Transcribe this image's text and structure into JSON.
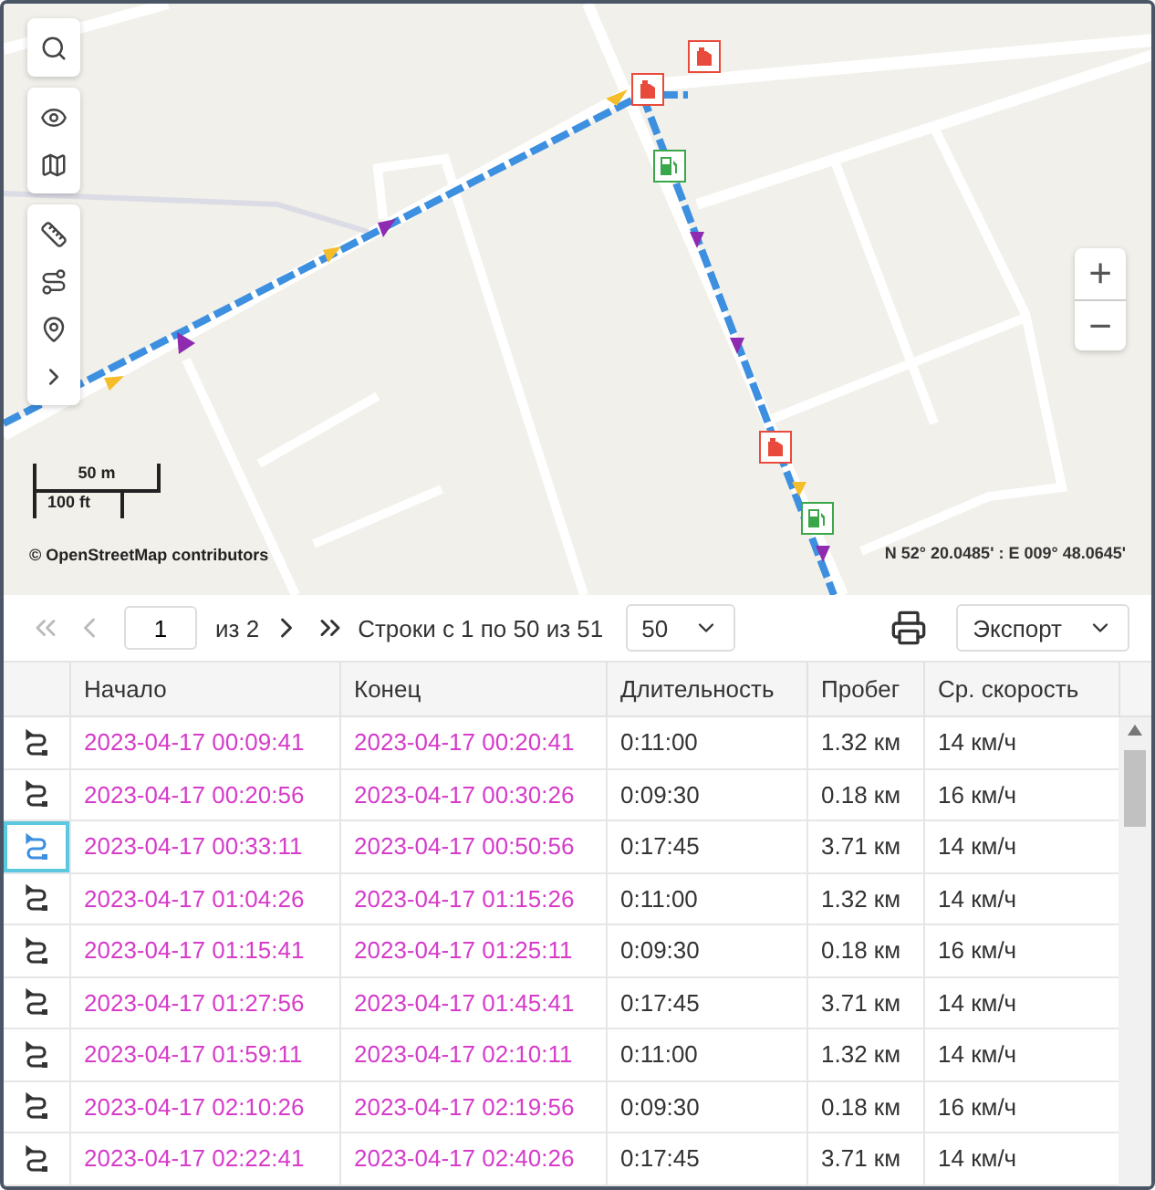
{
  "map": {
    "scale_metric": "50 m",
    "scale_imperial": "100 ft",
    "attribution": "© OpenStreetMap contributors",
    "coordinates": "N 52° 20.0485' : E 009° 48.0645'",
    "zoom_in": "+",
    "zoom_out": "−",
    "markers": [
      {
        "kind": "canister"
      },
      {
        "kind": "canister"
      },
      {
        "kind": "pump"
      },
      {
        "kind": "canister"
      },
      {
        "kind": "pump"
      }
    ]
  },
  "pager": {
    "page": "1",
    "of": "из 2",
    "range": "Строки с 1 по 50 из 51",
    "per_page": "50",
    "export": "Экспорт"
  },
  "table": {
    "columns": [
      "Начало",
      "Конец",
      "Длительность",
      "Пробег",
      "Ср. скорость"
    ],
    "rows": [
      {
        "start": "2023-04-17 00:09:41",
        "end": "2023-04-17 00:20:41",
        "duration": "0:11:00",
        "distance": "1.32 км",
        "speed": "14 км/ч",
        "selected": false
      },
      {
        "start": "2023-04-17 00:20:56",
        "end": "2023-04-17 00:30:26",
        "duration": "0:09:30",
        "distance": "0.18 км",
        "speed": "16 км/ч",
        "selected": false
      },
      {
        "start": "2023-04-17 00:33:11",
        "end": "2023-04-17 00:50:56",
        "duration": "0:17:45",
        "distance": "3.71 км",
        "speed": "14 км/ч",
        "selected": true
      },
      {
        "start": "2023-04-17 01:04:26",
        "end": "2023-04-17 01:15:26",
        "duration": "0:11:00",
        "distance": "1.32 км",
        "speed": "14 км/ч",
        "selected": false
      },
      {
        "start": "2023-04-17 01:15:41",
        "end": "2023-04-17 01:25:11",
        "duration": "0:09:30",
        "distance": "0.18 км",
        "speed": "16 км/ч",
        "selected": false
      },
      {
        "start": "2023-04-17 01:27:56",
        "end": "2023-04-17 01:45:41",
        "duration": "0:17:45",
        "distance": "3.71 км",
        "speed": "14 км/ч",
        "selected": false
      },
      {
        "start": "2023-04-17 01:59:11",
        "end": "2023-04-17 02:10:11",
        "duration": "0:11:00",
        "distance": "1.32 км",
        "speed": "14 км/ч",
        "selected": false
      },
      {
        "start": "2023-04-17 02:10:26",
        "end": "2023-04-17 02:19:56",
        "duration": "0:09:30",
        "distance": "0.18 км",
        "speed": "16 км/ч",
        "selected": false
      },
      {
        "start": "2023-04-17 02:22:41",
        "end": "2023-04-17 02:40:26",
        "duration": "0:17:45",
        "distance": "3.71 км",
        "speed": "14 км/ч",
        "selected": false
      }
    ]
  }
}
